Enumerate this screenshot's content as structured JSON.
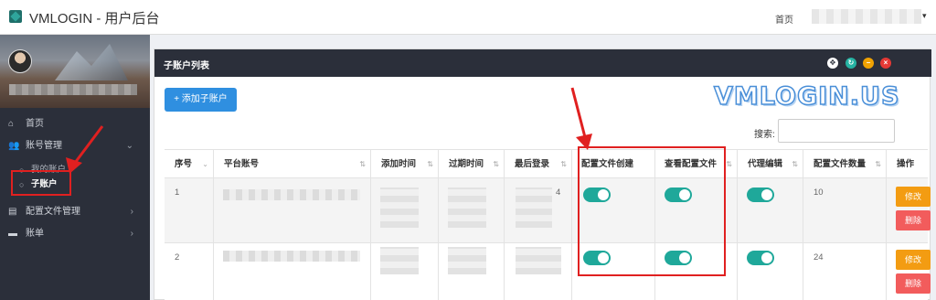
{
  "app": {
    "title": "VMLOGIN - 用户后台"
  },
  "topbar": {
    "home_label": "首页",
    "user_caret": "▾"
  },
  "sidebar": {
    "items": [
      {
        "icon": "home-icon",
        "glyph": "⌂",
        "label": "首页"
      },
      {
        "icon": "user-plus-icon",
        "glyph": "👥",
        "label": "账号管理",
        "arrow": "⌄"
      },
      {
        "icon": "file-icon",
        "glyph": "▤",
        "label": "配置文件管理",
        "arrow": "›"
      },
      {
        "icon": "card-icon",
        "glyph": "▬",
        "label": "账单",
        "arrow": "›"
      }
    ],
    "sub_items": [
      {
        "label": "我的账户"
      },
      {
        "label": "子账户",
        "active": true
      }
    ]
  },
  "panel": {
    "title": "子账户列表",
    "buttons": {
      "expand": "✥",
      "reload": "↻",
      "minimize": "−",
      "close": "×"
    }
  },
  "toolbar": {
    "add_label": "+ 添加子账户",
    "search_label": "搜索:",
    "search_value": ""
  },
  "watermark": "VMLOGIN.US",
  "table": {
    "headers": [
      "序号",
      "平台账号",
      "添加时间",
      "过期时间",
      "最后登录",
      "配置文件创建",
      "查看配置文件",
      "代理编辑",
      "配置文件数量",
      "操作"
    ],
    "sort_glyphs": [
      "⌄",
      "⇅",
      "⇅",
      "⇅",
      "⇅",
      "",
      "⇅",
      "⇅",
      "⇅",
      ""
    ],
    "rows": [
      {
        "index": "1",
        "last_login_tail": "4",
        "profile_create": true,
        "view_profile": true,
        "proxy_edit": true,
        "profile_count": "10",
        "edit_label": "修改",
        "delete_label": "删除"
      },
      {
        "index": "2",
        "last_login_tail": "",
        "profile_create": true,
        "view_profile": true,
        "proxy_edit": true,
        "profile_count": "24",
        "edit_label": "修改",
        "delete_label": "删除"
      }
    ]
  },
  "colors": {
    "accent_teal": "#1fa89a",
    "primary_blue": "#2f8fe0",
    "edit_orange": "#f39c12",
    "delete_red": "#f25c5c",
    "annotation_red": "#e02020"
  }
}
